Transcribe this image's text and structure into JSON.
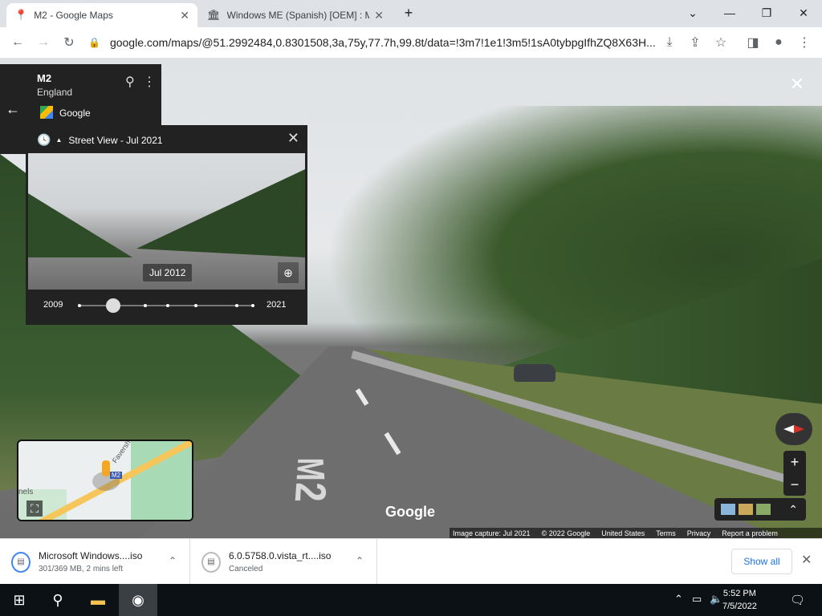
{
  "browser": {
    "tabs": [
      {
        "title": "M2 - Google Maps",
        "active": true,
        "icon": "maps-pin-icon"
      },
      {
        "title": "Windows ME (Spanish) [OEM] : M",
        "active": false,
        "icon": "archive-icon"
      }
    ],
    "url": "google.com/maps/@51.2992484,0.8301508,3a,75y,77.7h,99.8t/data=!3m7!1e1!3m5!1sA0tybpgIfhZQ8X63H..."
  },
  "maps": {
    "place_title": "M2",
    "place_subtitle": "England",
    "provider": "Google",
    "timemachine": {
      "header": "Street View - Jul 2021",
      "tooltip": "Jul 2012",
      "year_start": "2009",
      "year_end": "2021",
      "slider_position": 0.2
    },
    "minimap": {
      "road_label": "Faversh",
      "shield": "M2",
      "left_text": "nels"
    },
    "watermark": "Google",
    "road_marking": "M2",
    "footer": {
      "capture": "Image capture: Jul 2021",
      "copyright": "© 2022 Google",
      "country": "United States",
      "terms": "Terms",
      "privacy": "Privacy",
      "report": "Report a problem"
    }
  },
  "downloads": [
    {
      "name": "Microsoft Windows....iso",
      "status": "301/369 MB, 2 mins left"
    },
    {
      "name": "6.0.5758.0.vista_rt....iso",
      "status": "Canceled"
    }
  ],
  "show_all_label": "Show all",
  "taskbar": {
    "time": "5:52 PM",
    "date": "7/5/2022"
  }
}
